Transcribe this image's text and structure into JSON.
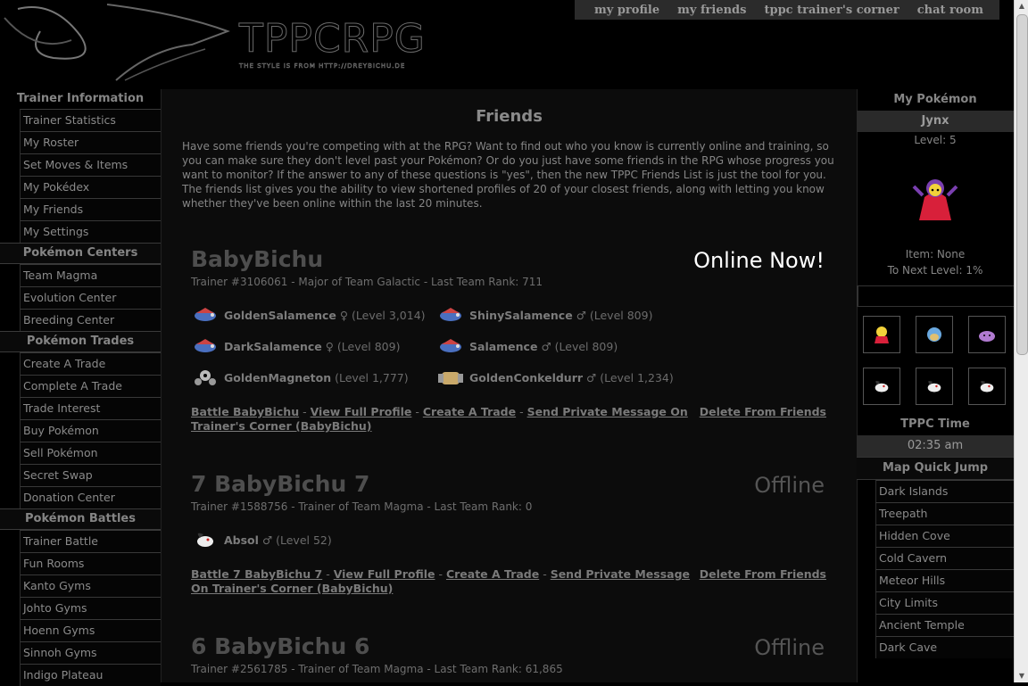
{
  "header": {
    "title": "TPPCRPG",
    "subtitle": "THE STYLE IS FROM HTTP://DREYBICHU.DE",
    "nav": [
      "my profile",
      "my friends",
      "tppc trainer's corner",
      "chat room"
    ]
  },
  "left_sidebar": {
    "sections": [
      {
        "title": "Trainer Information",
        "items": [
          "Trainer Statistics",
          "My Roster",
          "Set Moves & Items",
          "My Pokédex",
          "My Friends",
          "My Settings"
        ]
      },
      {
        "title": "Pokémon Centers",
        "items": [
          "Team Magma",
          "Evolution Center",
          "Breeding Center"
        ]
      },
      {
        "title": "Pokémon Trades",
        "items": [
          "Create A Trade",
          "Complete A Trade",
          "Trade Interest",
          "Buy Pokémon",
          "Sell Pokémon",
          "Secret Swap",
          "Donation Center"
        ]
      },
      {
        "title": "Pokémon Battles",
        "items": [
          "Trainer Battle",
          "Fun Rooms",
          "Kanto Gyms",
          "Johto Gyms",
          "Hoenn Gyms",
          "Sinnoh Gyms",
          "Indigo Plateau"
        ]
      }
    ]
  },
  "main": {
    "heading": "Friends",
    "intro": "Have some friends you're competing with at the RPG? Want to find out who you know is currently online and training, so you can make sure they don't level past your Pokémon? Or do you just have some friends in the RPG whose progress you want to monitor? If the answer to any of these questions is \"yes\", then the new TPPC Friends List is just the tool for you. The friends list gives you the ability to view shortened profiles of 20 of your closest friends, along with letting you know whether they've been online within the last 20 minutes.",
    "friends": [
      {
        "name": "BabyBichu",
        "status": "Online Now!",
        "info": "Trainer #3106061 - Major of Team Galactic - Last Team Rank: 711",
        "pokemon": [
          {
            "name": "GoldenSalamence",
            "detail": "♀ (Level 3,014)",
            "icon": "salamence-sprite"
          },
          {
            "name": "ShinySalamence",
            "detail": "♂ (Level 809)",
            "icon": "salamence-sprite"
          },
          {
            "name": "DarkSalamence",
            "detail": "♀ (Level 809)",
            "icon": "salamence-sprite"
          },
          {
            "name": "Salamence",
            "detail": "♂ (Level 809)",
            "icon": "salamence-sprite"
          },
          {
            "name": "GoldenMagneton",
            "detail": "(Level 1,777)",
            "icon": "magneton-sprite"
          },
          {
            "name": "GoldenConkeldurr",
            "detail": "♂ (Level 1,234)",
            "icon": "conkeldurr-sprite"
          }
        ],
        "actions": {
          "battle": "Battle BabyBichu",
          "profile": "View Full Profile",
          "trade": "Create A Trade",
          "message": "Send Private Message On Trainer's Corner (BabyBichu)",
          "delete": "Delete From Friends"
        }
      },
      {
        "name": "7 BabyBichu 7",
        "status": "Offline",
        "info": "Trainer #1588756 - Trainer of Team Magma - Last Team Rank: 0",
        "pokemon": [
          {
            "name": "Absol",
            "detail": "♂ (Level 52)",
            "icon": "absol-sprite"
          }
        ],
        "actions": {
          "battle": "Battle 7 BabyBichu 7",
          "profile": "View Full Profile",
          "trade": "Create A Trade",
          "message": "Send Private Message On Trainer's Corner (BabyBichu)",
          "delete": "Delete From Friends"
        }
      },
      {
        "name": "6 BabyBichu 6",
        "status": "Offline",
        "info": "Trainer #2561785 - Trainer of Team Magma - Last Team Rank: 61,865"
      }
    ]
  },
  "right_sidebar": {
    "my_pokemon_title": "My Pokémon",
    "pokemon_name": "Jynx",
    "level": "Level: 5",
    "item": "Item: None",
    "next_level": "To Next Level: 1%",
    "team_icons": [
      "jynx-sprite",
      "squirtle-sprite",
      "ditto-sprite",
      "absol-sprite",
      "absol-sprite",
      "absol-sprite"
    ],
    "time_title": "TPPC Time",
    "time": "02:35 am",
    "map_title": "Map Quick Jump",
    "map_items": [
      "Dark Islands",
      "Treepath",
      "Hidden Cove",
      "Cold Cavern",
      "Meteor Hills",
      "City Limits",
      "Ancient Temple",
      "Dark Cave"
    ]
  },
  "colors": {
    "background": "#000000",
    "panel": "#0c0c0c",
    "bar": "#2a2a2a",
    "online": "#ffffff"
  }
}
